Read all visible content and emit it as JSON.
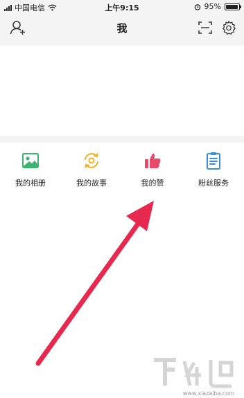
{
  "status_bar": {
    "carrier": "中国电信",
    "time": "上午9:15",
    "battery_percent": "95%",
    "battery_level": 0.95
  },
  "nav": {
    "title": "我"
  },
  "grid": [
    {
      "label": "我的相册",
      "icon": "photo-album-icon",
      "color": "#3cb371"
    },
    {
      "label": "我的故事",
      "icon": "story-icon",
      "color": "#f0b020"
    },
    {
      "label": "我的赞",
      "icon": "thumbs-up-icon",
      "color": "#e84a6a"
    },
    {
      "label": "粉丝服务",
      "icon": "clipboard-icon",
      "color": "#3a8fd8"
    }
  ],
  "annotation": {
    "arrow_color": "#e8294f"
  },
  "watermark": {
    "site": "www.xiazaiba.com"
  }
}
